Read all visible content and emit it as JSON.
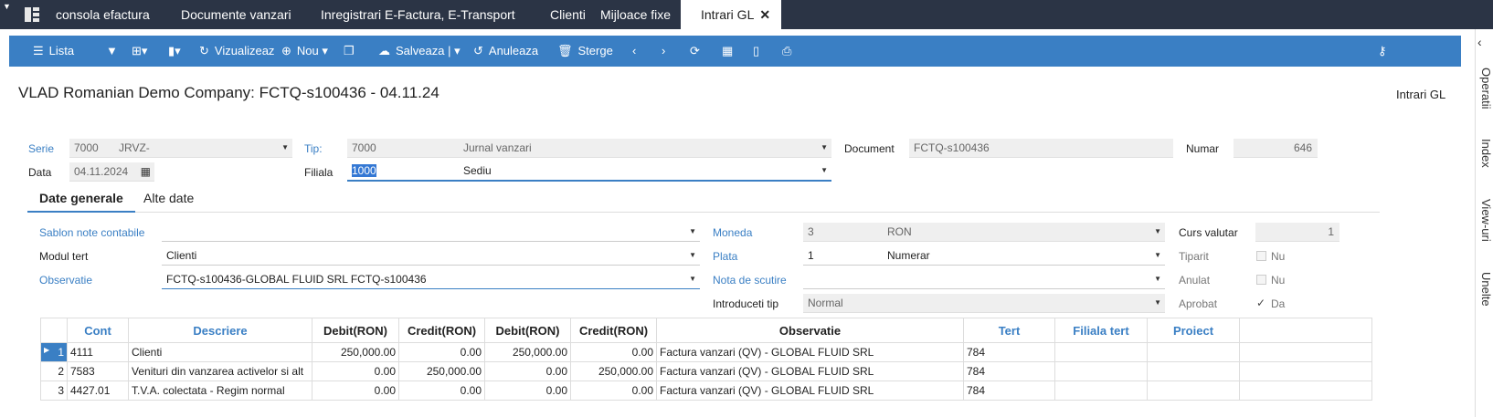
{
  "tabs": [
    "consola efactura",
    "Documente vanzari",
    "Inregistrari E-Factura, E-Transport",
    "Clienti",
    "Mijloace fixe",
    "Intrari GL"
  ],
  "toolbar": {
    "lista": "Lista",
    "vizualizeaza": "Vizualizeaz",
    "nou": "Nou",
    "salveaza": "Salveaza",
    "anuleaza": "Anuleaza",
    "sterge": "Sterge"
  },
  "side_tabs": [
    "Operatii",
    "Index",
    "View-uri",
    "Unelte"
  ],
  "title": "VLAD Romanian Demo Company: FCTQ-s100436 - 04.11.24",
  "title_right": "Intrari GL",
  "header": {
    "serie_label": "Serie",
    "serie_code": "7000",
    "serie_name": "JRVZ-",
    "tip_label": "Tip:",
    "tip_code": "7000",
    "tip_name": "Jurnal vanzari",
    "document_label": "Document",
    "document_value": "FCTQ-s100436",
    "numar_label": "Numar",
    "numar_value": "646",
    "data_label": "Data",
    "data_value": "04.11.2024",
    "filiala_label": "Filiala",
    "filiala_code": "1000",
    "filiala_name": "Sediu"
  },
  "subtabs": [
    "Date generale",
    "Alte date"
  ],
  "general": {
    "sablon_label": "Sablon note contabile",
    "sablon_value": "",
    "modul_label": "Modul tert",
    "modul_value": "Clienti",
    "obs_label": "Observatie",
    "obs_value": "FCTQ-s100436-GLOBAL FLUID SRL FCTQ-s100436",
    "moneda_label": "Moneda",
    "moneda_code": "3",
    "moneda_name": "RON",
    "plata_label": "Plata",
    "plata_code": "1",
    "plata_name": "Numerar",
    "nota_label": "Nota de scutire",
    "nota_value": "",
    "introduceti_label": "Introduceti tip",
    "introduceti_value": "Normal",
    "curs_label": "Curs valutar",
    "curs_value": "1",
    "tiparit_label": "Tiparit",
    "tiparit_value": "Nu",
    "anulat_label": "Anulat",
    "anulat_value": "Nu",
    "aprobat_label": "Aprobat",
    "aprobat_value": "Da"
  },
  "grid": {
    "columns": [
      "Cont",
      "Descriere",
      "Debit(RON)",
      "Credit(RON)",
      "Debit(RON)",
      "Credit(RON)",
      "Observatie",
      "Tert",
      "Filiala tert",
      "Proiect"
    ],
    "rows": [
      {
        "n": "1",
        "cont": "4111",
        "descriere": "Clienti",
        "debit": "250,000.00",
        "credit": "0.00",
        "debit2": "250,000.00",
        "credit2": "0.00",
        "obs": "Factura vanzari (QV) - GLOBAL FLUID SRL",
        "tert": "784"
      },
      {
        "n": "2",
        "cont": "7583",
        "descriere": "Venituri din vanzarea activelor si alt",
        "debit": "0.00",
        "credit": "250,000.00",
        "debit2": "0.00",
        "credit2": "250,000.00",
        "obs": "Factura vanzari (QV) - GLOBAL FLUID SRL",
        "tert": "784"
      },
      {
        "n": "3",
        "cont": "4427.01",
        "descriere": "T.V.A. colectata - Regim normal",
        "debit": "0.00",
        "credit": "0.00",
        "debit2": "0.00",
        "credit2": "0.00",
        "obs": "Factura vanzari (QV) - GLOBAL FLUID SRL",
        "tert": "784"
      }
    ]
  }
}
